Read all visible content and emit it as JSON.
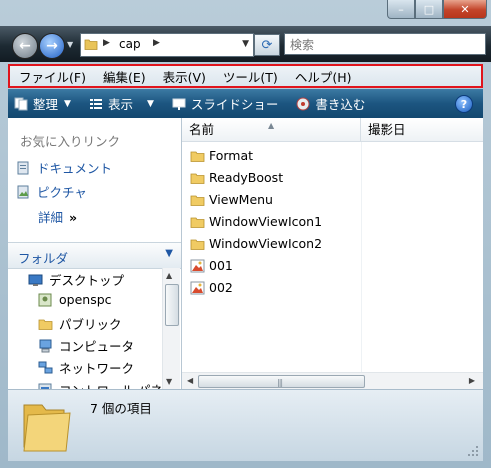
{
  "window": {
    "caption_buttons": {
      "minimize": "–",
      "maximize": "□",
      "close": "✕"
    }
  },
  "navigation": {
    "back_icon": "back-arrow-icon",
    "forward_icon": "forward-arrow-icon",
    "address": {
      "path_segment": "cap"
    },
    "search_placeholder": "検索"
  },
  "menubar": {
    "items": [
      "ファイル(F)",
      "編集(E)",
      "表示(V)",
      "ツール(T)",
      "ヘルプ(H)"
    ],
    "highlight_color": "#e0141c"
  },
  "toolbar": {
    "organize": "整理",
    "views": "表示",
    "slideshow": "スライドショー",
    "burn": "書き込む",
    "help": "?"
  },
  "navpane": {
    "favorites_title": "お気に入りリンク",
    "favorites": [
      "ドキュメント",
      "ピクチャ"
    ],
    "more_label": "詳細",
    "more_chevron": "»",
    "folders_label": "フォルダ",
    "tree": [
      "デスクトップ",
      "openspc",
      "パブリック",
      "コンピュータ",
      "ネットワーク",
      "コントロール パネル"
    ]
  },
  "filelist": {
    "columns": [
      "名前",
      "撮影日"
    ],
    "items": [
      {
        "name": "Format",
        "icon": "folder-icon"
      },
      {
        "name": "ReadyBoost",
        "icon": "folder-icon"
      },
      {
        "name": "ViewMenu",
        "icon": "folder-icon"
      },
      {
        "name": "WindowViewIcon1",
        "icon": "folder-icon"
      },
      {
        "name": "WindowViewIcon2",
        "icon": "folder-icon"
      },
      {
        "name": "001",
        "icon": "image-file-icon"
      },
      {
        "name": "002",
        "icon": "image-file-icon"
      }
    ]
  },
  "details": {
    "item_count": "7 個の項目"
  }
}
